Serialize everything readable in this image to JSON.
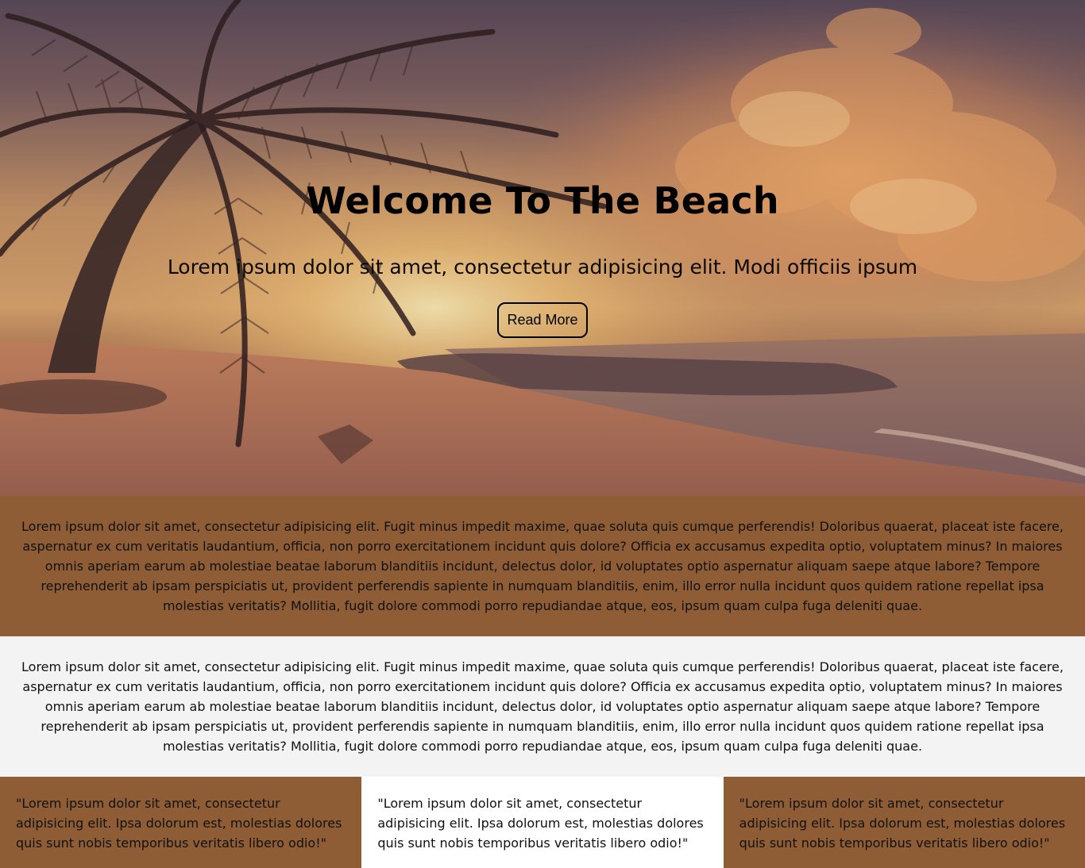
{
  "hero": {
    "title": "Welcome To The Beach",
    "subtitle": "Lorem ipsum dolor sit amet, consectetur adipisicing elit. Modi officiis ipsum",
    "button_label": "Read More"
  },
  "bands": [
    {
      "text": "Lorem ipsum dolor sit amet, consectetur adipisicing elit. Fugit minus impedit maxime, quae soluta quis cumque perferendis! Doloribus quaerat, placeat iste facere, aspernatur ex cum veritatis laudantium, officia, non porro exercitationem incidunt quis dolore? Officia ex accusamus expedita optio, voluptatem minus? In maiores omnis aperiam earum ab molestiae beatae laborum blanditiis incidunt, delectus dolor, id voluptates optio aspernatur aliquam saepe atque labore? Tempore reprehenderit ab ipsam perspiciatis ut, provident perferendis sapiente in numquam blanditiis, enim, illo error nulla incidunt quos quidem ratione repellat ipsa molestias veritatis? Mollitia, fugit dolore commodi porro repudiandae atque, eos, ipsum quam culpa fuga deleniti quae."
    },
    {
      "text": "Lorem ipsum dolor sit amet, consectetur adipisicing elit. Fugit minus impedit maxime, quae soluta quis cumque perferendis! Doloribus quaerat, placeat iste facere, aspernatur ex cum veritatis laudantium, officia, non porro exercitationem incidunt quis dolore? Officia ex accusamus expedita optio, voluptatem minus? In maiores omnis aperiam earum ab molestiae beatae laborum blanditiis incidunt, delectus dolor, id voluptates optio aspernatur aliquam saepe atque labore? Tempore reprehenderit ab ipsam perspiciatis ut, provident perferendis sapiente in numquam blanditiis, enim, illo error nulla incidunt quos quidem ratione repellat ipsa molestias veritatis? Mollitia, fugit dolore commodi porro repudiandae atque, eos, ipsum quam culpa fuga deleniti quae."
    }
  ],
  "quotes": [
    {
      "text": "\"Lorem ipsum dolor sit amet, consectetur adipisicing elit. Ipsa dolorum est, molestias dolores quis sunt nobis temporibus veritatis libero odio!\""
    },
    {
      "text": "\"Lorem ipsum dolor sit amet, consectetur adipisicing elit. Ipsa dolorum est, molestias dolores quis sunt nobis temporibus veritatis libero odio!\""
    },
    {
      "text": "\"Lorem ipsum dolor sit amet, consectetur adipisicing elit. Ipsa dolorum est, molestias dolores quis sunt nobis temporibus veritatis libero odio!\""
    }
  ],
  "colors": {
    "band_brown": "#8e5d36",
    "band_grey": "#f3f3f3",
    "quote_white": "#ffffff"
  }
}
